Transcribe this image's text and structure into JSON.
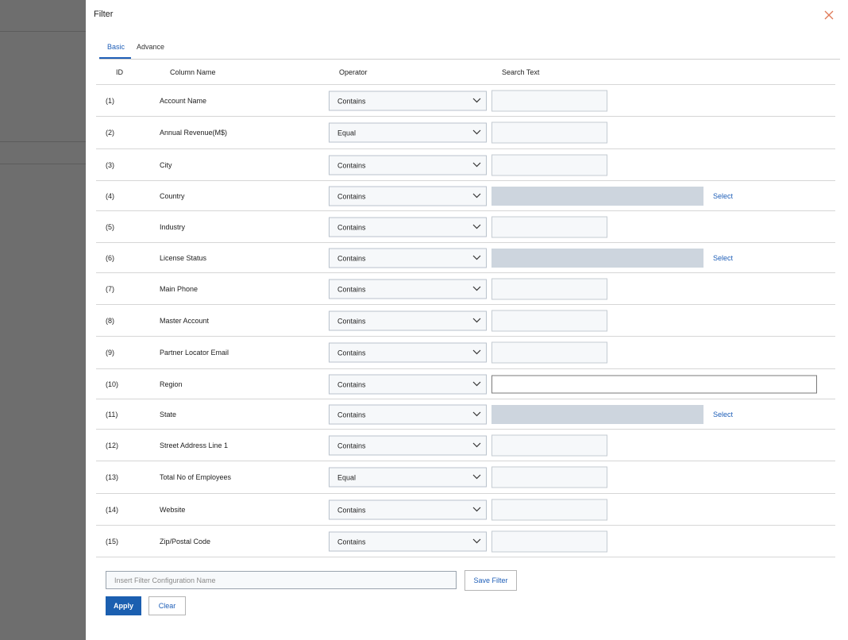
{
  "dialog": {
    "title": "Filter",
    "close_icon": "close-icon",
    "accent_color": "#1f5fb8"
  },
  "tabs": [
    {
      "label": "Basic",
      "active": true
    },
    {
      "label": "Advance",
      "active": false
    }
  ],
  "columns": {
    "id": "ID",
    "column_name": "Column Name",
    "operator": "Operator",
    "search_text": "Search Text"
  },
  "rows": [
    {
      "id": "(1)",
      "name": "Account Name",
      "operator": "Contains",
      "input": "small",
      "value": "",
      "select": ""
    },
    {
      "id": "(2)",
      "name": "Annual Revenue(M$)",
      "operator": "Equal",
      "input": "small",
      "value": "",
      "select": ""
    },
    {
      "id": "(3)",
      "name": "City",
      "operator": "Contains",
      "input": "small",
      "value": "",
      "select": ""
    },
    {
      "id": "(4)",
      "name": "Country",
      "operator": "Contains",
      "input": "lookup",
      "value": "",
      "select": "Select"
    },
    {
      "id": "(5)",
      "name": "Industry",
      "operator": "Contains",
      "input": "small",
      "value": "",
      "select": ""
    },
    {
      "id": "(6)",
      "name": "License Status",
      "operator": "Contains",
      "input": "lookup",
      "value": "",
      "select": "Select"
    },
    {
      "id": "(7)",
      "name": "Main Phone",
      "operator": "Contains",
      "input": "small",
      "value": "",
      "select": ""
    },
    {
      "id": "(8)",
      "name": "Master Account",
      "operator": "Contains",
      "input": "small",
      "value": "",
      "select": ""
    },
    {
      "id": "(9)",
      "name": "Partner Locator Email",
      "operator": "Contains",
      "input": "small",
      "value": "",
      "select": ""
    },
    {
      "id": "(10)",
      "name": "Region",
      "operator": "Contains",
      "input": "wide",
      "value": "",
      "select": ""
    },
    {
      "id": "(11)",
      "name": "State",
      "operator": "Contains",
      "input": "lookup",
      "value": "",
      "select": "Select"
    },
    {
      "id": "(12)",
      "name": "Street Address Line 1",
      "operator": "Contains",
      "input": "small",
      "value": "",
      "select": ""
    },
    {
      "id": "(13)",
      "name": "Total No of Employees",
      "operator": "Equal",
      "input": "small",
      "value": "",
      "select": ""
    },
    {
      "id": "(14)",
      "name": "Website",
      "operator": "Contains",
      "input": "small",
      "value": "",
      "select": ""
    },
    {
      "id": "(15)",
      "name": "Zip/Postal Code",
      "operator": "Contains",
      "input": "small",
      "value": "",
      "select": ""
    }
  ],
  "footer": {
    "config_placeholder": "Insert Filter Configuration Name",
    "config_value": "",
    "save_label": "Save Filter",
    "apply_label": "Apply",
    "clear_label": "Clear",
    "apply_color": "#1b5fb0"
  }
}
